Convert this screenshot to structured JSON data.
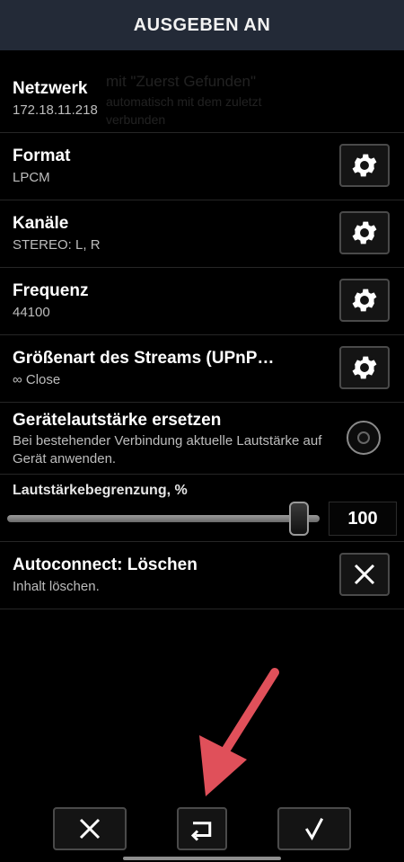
{
  "header": {
    "title": "AUSGEBEN AN"
  },
  "ghost_text": {
    "line1": "mit \"Zuerst Gefunden\"",
    "line2": "automatisch mit dem zuletzt",
    "line3": "verbunden"
  },
  "rows": {
    "network": {
      "title": "Netzwerk",
      "value": "172.18.11.218"
    },
    "format": {
      "title": "Format",
      "value": "LPCM"
    },
    "channels": {
      "title": "Kanäle",
      "value": "STEREO: L, R"
    },
    "frequency": {
      "title": "Frequenz",
      "value": "44100"
    },
    "stream_size": {
      "title": "Größenart des Streams (UPnP…",
      "value": "∞ Close"
    },
    "device_volume": {
      "title": "Gerätelautstärke ersetzen",
      "description": "Bei bestehender Verbindung aktuelle Lautstärke auf Gerät anwenden."
    },
    "volume_limit": {
      "label": "Lautstärkebegrenzung, %",
      "value": "100",
      "level": 1.0
    },
    "autoconnect": {
      "title": "Autoconnect: Löschen",
      "value": "Inhalt löschen."
    }
  },
  "icons": {
    "settings": "gear-icon",
    "clear": "close-icon",
    "cancel": "close-icon",
    "back": "return-icon",
    "confirm": "checkmark-icon"
  },
  "colors": {
    "header_bg": "#232a37",
    "background": "#000000",
    "annotation_arrow": "#e0505a"
  }
}
